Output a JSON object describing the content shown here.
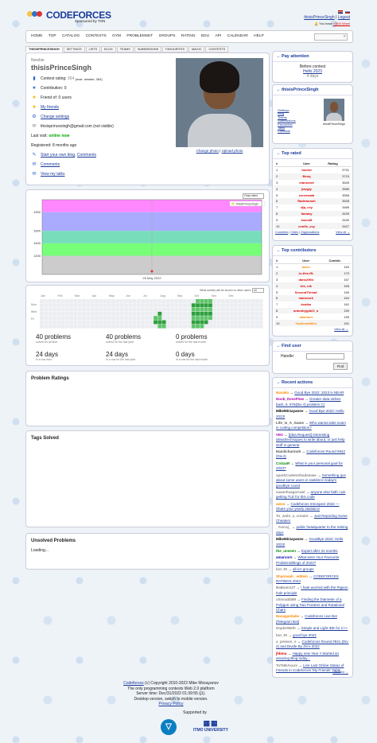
{
  "header": {
    "brand": "CODEFORCES",
    "sponsored": "Sponsored by TON",
    "user_link": "thisisPrinceSingh",
    "separator": "|",
    "logout": "Logout",
    "new_prefix": "You have",
    "new_link": "+364! Wow!"
  },
  "menu": [
    "HOME",
    "TOP",
    "CATALOG",
    "CONTESTS",
    "GYM",
    "PROBLEMSET",
    "GROUPS",
    "RATING",
    "EDU",
    "API",
    "CALENDAR",
    "HELP"
  ],
  "tabs": [
    "THISISPRINCESINGH",
    "SETTINGS",
    "LISTS",
    "BLOG",
    "TEAMS",
    "SUBMISSIONS",
    "FAVOURITES",
    "MAGIC",
    "CONTESTS"
  ],
  "profile": {
    "rank": "Newbie",
    "handle": "thisisPrinceSingh",
    "rating_label": "Contest rating:",
    "rating_value": "364",
    "rating_max": "(max. newbie, 364)",
    "contribution": "Contribution: 0",
    "friend_of": "Friend of: 0 users",
    "my_friends": "My friends",
    "change_settings": "Change settings",
    "email": "thisisprincesingh@gmail.com (not visible)",
    "last_visit_label": "Last visit:",
    "last_visit_value": "online now",
    "registered": "Registered: 8 months ago",
    "start_blog": "Start your own blog",
    "comments": "Comments",
    "talks": "View my talks",
    "change_photo": "Change photo",
    "upload_photo": "Upload photo"
  },
  "graph": {
    "select": "Only rated",
    "date_label": "25 May 2022",
    "legend": "thisisPrinceSingh"
  },
  "chart_data": {
    "type": "line",
    "title": "",
    "ylim": [
      900,
      2100
    ],
    "y_ticks": [
      1200,
      1400,
      1600,
      1900
    ],
    "series": [
      {
        "name": "thisisPrinceSingh",
        "x": [
          "25 May 2022"
        ],
        "values": [
          364
        ]
      }
    ]
  },
  "heatmap": {
    "caption": "What activity will be shown to other users:",
    "caption_select": "All",
    "months": [
      "Jan",
      "Feb",
      "Mar",
      "Apr",
      "May",
      "Jun",
      "Jul",
      "Aug",
      "Sep",
      "Oct",
      "Nov",
      "Dec"
    ],
    "days": [
      "Mon",
      "Wed",
      "Fri"
    ],
    "stats": [
      {
        "value": "40 problems",
        "label": "solved for all time"
      },
      {
        "value": "40 problems",
        "label": "solved for the last year"
      },
      {
        "value": "0 problems",
        "label": "solved for the last month"
      },
      {
        "value": "24 days",
        "label": "in a row max."
      },
      {
        "value": "24 days",
        "label": "in a row for the last year"
      },
      {
        "value": "0 days",
        "label": "in a row for the last month"
      }
    ]
  },
  "sections": {
    "problem_ratings": "Problem Ratings",
    "tags_solved": "Tags Solved",
    "unsolved": "Unsolved Problems",
    "loading": "Loading..."
  },
  "sidebar": {
    "pay_attention": {
      "title": "Pay attention",
      "before": "Before contest",
      "contest": "Hello 2023",
      "days": "4 days"
    },
    "user_box": {
      "title": "thisisPrinceSingh",
      "links": [
        "Settings",
        "Blog",
        "Teams",
        "Submissions",
        "Favourites",
        "Talks",
        "Contests"
      ],
      "caption": "thisisPrinceSingh"
    },
    "top_rated": {
      "title": "Top rated",
      "headers": [
        "#",
        "User",
        "Rating"
      ],
      "rows": [
        [
          "1",
          "tourist",
          "3731"
        ],
        [
          "2",
          "Benq",
          "3715"
        ],
        [
          "3",
          "maroonrk",
          "3645"
        ],
        [
          "4",
          "jiangly",
          "3585"
        ],
        [
          "5",
          "ecnerwala",
          "3558"
        ],
        [
          "6",
          "Radewoosh",
          "3528"
        ],
        [
          "7",
          "djq_cxy",
          "3486"
        ],
        [
          "8",
          "fantasy",
          "3439"
        ],
        [
          "9",
          "ksun48",
          "3430"
        ],
        [
          "10",
          "cnnfls_csy",
          "3427"
        ]
      ],
      "footer_links": [
        "Countries",
        "Cities",
        "Organizations"
      ],
      "view_all": "View all →"
    },
    "top_contrib": {
      "title": "Top contributors",
      "headers": [
        "#",
        "User",
        "Contrib."
      ],
      "rows": [
        [
          "1",
          "awoo",
          "183"
        ],
        [
          "2",
          "-is-this-fft-",
          "179"
        ],
        [
          "3",
          "dario2994",
          "167"
        ],
        [
          "4",
          "Um_nik",
          "165"
        ],
        [
          "5",
          "SecondThread",
          "165"
        ],
        [
          "6",
          "maroonrk",
          "164"
        ],
        [
          "7",
          "kostka",
          "162"
        ],
        [
          "8",
          "antontrygubO_o",
          "159"
        ],
        [
          "9",
          "adamant",
          "155"
        ],
        [
          "10",
          "YouKnowWho",
          "151"
        ]
      ],
      "view_all": "View all →"
    },
    "find_user": {
      "title": "Find user",
      "handle_label": "Handle:",
      "button": "Find"
    },
    "recent_actions": {
      "title": "Recent actions",
      "items": [
        {
          "user": "Nanako",
          "text": "Good Bye 2022: 2023 is NEAR"
        },
        {
          "user": "Noob_DeveFlow",
          "text": "Greater data strikes back, 6. 876(Div 4) problem C)"
        },
        {
          "user": "MikeMirzayanov",
          "text": "Good Bye 2022: Hello 2023!"
        },
        {
          "user": "Life_is_A_Game",
          "text": "Who wanna take exam in coding competition?"
        },
        {
          "user": "VIKI",
          "text": "[Idea Request] Interesting ideas/techniques to write about, or just help stuff in general"
        },
        {
          "user": "Hamilcharmoh",
          "text": "Codeforces Round #842 (Div.2)"
        },
        {
          "user": "CoSaxR",
          "text": "What is your personal goal for 2023?"
        },
        {
          "user": "sparkCodeInShadeIowe",
          "text": "Something gus about some users in ranklist in today's goodbye round"
        },
        {
          "user": "saaanhaagarrawl",
          "text": "anyone else faith i am getting TLE for this code"
        },
        {
          "user": "awoo",
          "text": "Codeforces Introspect 2022 — Share your yearly statistics!"
        },
        {
          "user": "To_Jatin_a_creater",
          "text": "Just Reporting Some Cheaters"
        },
        {
          "user": "_Yuvraj_",
          "text": "public headquarter to the retiring days"
        },
        {
          "user": "MikeMirzayanov",
          "text": "GoodBye 2022: Hello 2023!"
        },
        {
          "user": "the_unseen",
          "text": "Expert after 31 months"
        },
        {
          "user": "amarcorn",
          "text": "What were Your Favourite Problems/Blogs of 2022?"
        },
        {
          "user": "bot_RI",
          "text": "all-ics groups"
        },
        {
          "user": "Sharmsah_ editein",
          "text": "CODEFORCES RATINGS 2044"
        },
        {
          "user": "BaBaim127",
          "text": "I hate worried with the Pigeon hole principle"
        },
        {
          "user": "chinnabb89",
          "text": "Finding the Diameter of a Polygon using Two Pointers and Rotational Chars"
        },
        {
          "user": "Nanaganbake",
          "text": "Codeforces Live Bot [Telegram Bot]"
        },
        {
          "user": "DoplerMeth",
          "text": "Simple and Light IDE for C++"
        },
        {
          "user": "bot_RI",
          "text": "good bye 2022"
        },
        {
          "user": "a_peiwon_s",
          "text": "Codeforces Round #841 (Div. 2) and Divide By Zero 2022"
        },
        {
          "user": "jhbmu",
          "text": "Happy new Year !! Started an amazing Blog today..."
        },
        {
          "user": "ToTHEAsure",
          "text": "Line Last Online Status of Friends in Codeforces 'My Friends' Table"
        }
      ],
      "detailed": "Detailed →"
    }
  },
  "footer": {
    "line1_link": "Codeforces",
    "line1": " (c) Copyright 2010-2022 Mike Mirzayanov",
    "line2": "The only programming contests Web 2.0 platform",
    "line3": "Server time: Dec/31/2022 01:39:55 (j1).",
    "line4": "Desktop version, switch to mobile version.",
    "line5": "Privacy Policy",
    "supported": "Supported by",
    "itmo": "ITMO UNIVERSITY"
  }
}
